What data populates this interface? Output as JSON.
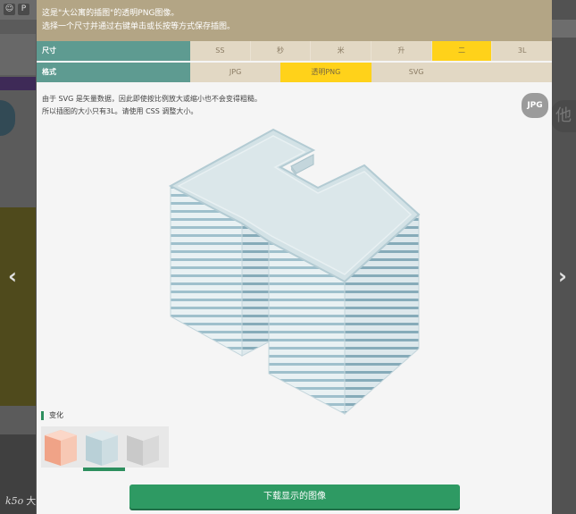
{
  "modal": {
    "header_line1": "这是\"大公寓的插图\"的透明PNG图像。",
    "header_line2": "选择一个尺寸并通过右键单击或长按等方式保存插图。",
    "size_row": {
      "label": "尺寸",
      "options": [
        "SS",
        "秒",
        "米",
        "升",
        "二",
        "3L"
      ],
      "selected": "二"
    },
    "format_row": {
      "label": "格式",
      "options": [
        "JPG",
        "透明PNG",
        "SVG",
        ""
      ],
      "selected": "透明PNG"
    },
    "description_line1": "由于 SVG 是矢量数据，因此即使按比例放大或缩小也不会变得粗糙。",
    "description_line2": "所以插图的大小只有3L。请使用 CSS 调整大小。",
    "jpg_badge": "JPG",
    "variants_title": "变化",
    "variants": [
      "orange-building-variant",
      "blue-building-variant",
      "gray-building-variant"
    ],
    "selected_variant": 1,
    "download_label": "下载显示的图像"
  },
  "background": {
    "nav_prev": "‹",
    "nav_next": "›",
    "right_glyph": "他",
    "watermark_text": "大眼滑镜",
    "watermark_logo": "k5o"
  },
  "colors": {
    "header_bg": "#b3a585",
    "label_bg": "#5e9b91",
    "cell_bg": "#e2d8c4",
    "selected_bg": "#ffd21a",
    "download_bg": "#2e9a63"
  }
}
